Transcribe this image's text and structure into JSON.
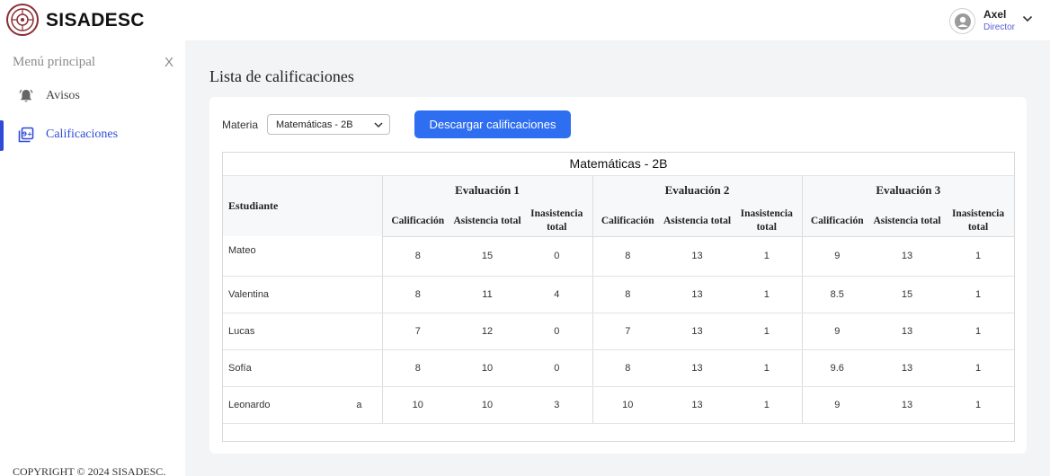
{
  "app": {
    "title": "SISADESC"
  },
  "user": {
    "name": "Axel",
    "role": "Director"
  },
  "sidebar": {
    "title": "Menú principal",
    "close_label": "X",
    "items": [
      {
        "label": "Avisos",
        "icon": "bell-icon"
      },
      {
        "label": "Calificaciones",
        "icon": "grades-icon",
        "active": true
      }
    ],
    "copyright": "COPYRIGHT © 2024 SISADESC."
  },
  "main": {
    "title": "Lista de calificaciones",
    "filter_label": "Materia",
    "select_value": "Matemáticas - 2B",
    "download_label": "Descargar calificaciones"
  },
  "table": {
    "title": "Matemáticas - 2B",
    "student_header": "Estudiante",
    "evaluations": [
      "Evaluación 1",
      "Evaluación 2",
      "Evaluación 3"
    ],
    "sub_headers": [
      "Calificación",
      "Asistencia total",
      "Inasistencia total"
    ],
    "rows": [
      {
        "name": "Mateo",
        "values": [
          "8",
          "15",
          "0",
          "8",
          "13",
          "1",
          "9",
          "13",
          "1"
        ]
      },
      {
        "name": "Valentina",
        "values": [
          "8",
          "11",
          "4",
          "8",
          "13",
          "1",
          "8.5",
          "15",
          "1"
        ]
      },
      {
        "name": "Lucas",
        "values": [
          "7",
          "12",
          "0",
          "7",
          "13",
          "1",
          "9",
          "13",
          "1"
        ]
      },
      {
        "name": "Sofía",
        "values": [
          "8",
          "10",
          "0",
          "8",
          "13",
          "1",
          "9.6",
          "13",
          "1"
        ]
      },
      {
        "name": "Leonardo",
        "trailing": "a",
        "values": [
          "10",
          "10",
          "3",
          "10",
          "13",
          "1",
          "9",
          "13",
          "1"
        ]
      }
    ]
  },
  "colors": {
    "accent": "#2e6ff2",
    "active_nav": "#2e4bd8",
    "role": "#5a5fd6",
    "logo": "#8a2e34"
  }
}
